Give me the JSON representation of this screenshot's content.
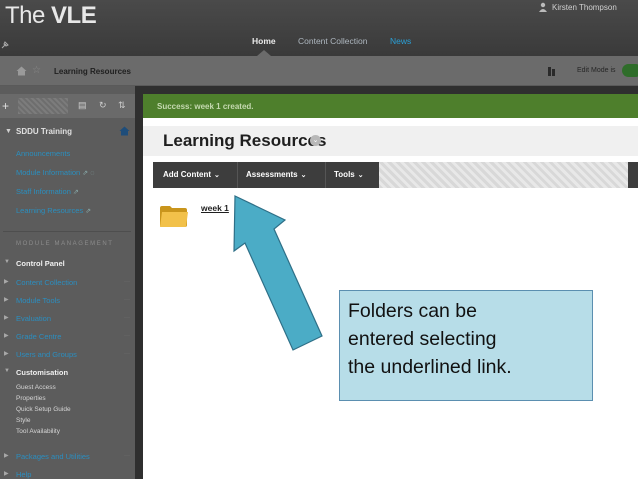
{
  "header": {
    "logo_prefix": "The ",
    "logo_bold": "VLE",
    "user_name": "Kirsten Thompson",
    "tabs": [
      "Home",
      "Content Collection",
      "News"
    ]
  },
  "breadcrumb": {
    "current": "Learning Resources",
    "edit_mode_label": "Edit Mode is"
  },
  "sidebar": {
    "course_name": "SDDU Training",
    "links": [
      {
        "label": "Announcements"
      },
      {
        "label": "Module Information"
      },
      {
        "label": "Staff Information"
      },
      {
        "label": "Learning Resources"
      }
    ],
    "section_label": "MODULE MANAGEMENT",
    "control_panel": "Control Panel",
    "cp_items": [
      "Content Collection",
      "Module Tools",
      "Evaluation",
      "Grade Centre",
      "Users and Groups",
      "Customisation"
    ],
    "customisation_sub": [
      "Guest Access",
      "Properties",
      "Quick Setup Guide",
      "Style",
      "Tool Availability"
    ],
    "bottom_items": [
      "Packages and Utilities",
      "Help"
    ]
  },
  "main": {
    "success_message": "Success: week 1 created.",
    "page_title": "Learning Resources",
    "actions": [
      "Add Content",
      "Assessments",
      "Tools"
    ],
    "item_link": "week 1"
  },
  "annotation": {
    "lines": [
      "Folders can be",
      "entered selecting",
      "the underlined link."
    ],
    "fill_color": "#b7dde8",
    "arrow_color": "#4bacc6"
  },
  "colors": {
    "success_bar": "#4e7f2c",
    "action_bar": "#3d3d3d",
    "link": "#2a8fbf"
  }
}
